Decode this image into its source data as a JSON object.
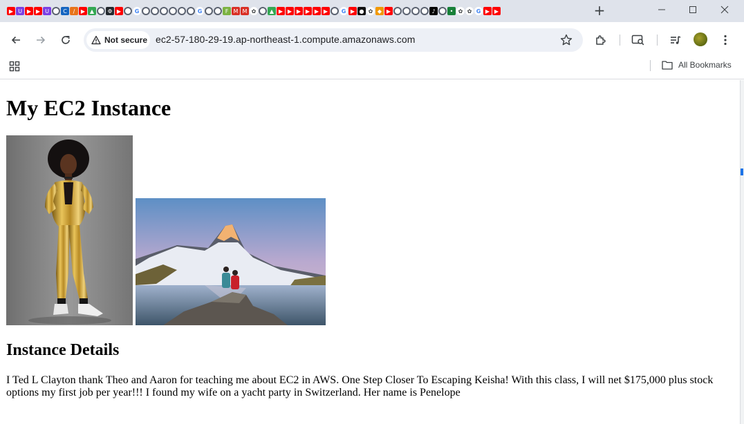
{
  "browser": {
    "tab_favicons": [
      {
        "name": "youtube-icon",
        "color": "#ff0000"
      },
      {
        "name": "u-icon",
        "color": "#7b3fe4"
      },
      {
        "name": "youtube-icon",
        "color": "#ff0000"
      },
      {
        "name": "youtube-icon",
        "color": "#ff0000"
      },
      {
        "name": "u-icon",
        "color": "#7b3fe4"
      },
      {
        "name": "globe-icon",
        "color": "#5f6368"
      },
      {
        "name": "c-icon",
        "color": "#1565c0"
      },
      {
        "name": "stripe-icon",
        "color": "#e8731a"
      },
      {
        "name": "youtube-icon",
        "color": "#ff0000"
      },
      {
        "name": "drive-icon",
        "color": "#34a853"
      },
      {
        "name": "globe-icon",
        "color": "#5f6368"
      },
      {
        "name": "gh-icon",
        "color": "#24292f"
      },
      {
        "name": "youtube-icon",
        "color": "#ff0000"
      },
      {
        "name": "globe-icon",
        "color": "#5f6368"
      },
      {
        "name": "google-icon",
        "color": "#4285f4"
      },
      {
        "name": "globe-icon",
        "color": "#5f6368"
      },
      {
        "name": "globe-icon",
        "color": "#5f6368"
      },
      {
        "name": "globe-icon",
        "color": "#5f6368"
      },
      {
        "name": "globe-icon",
        "color": "#5f6368"
      },
      {
        "name": "globe-icon",
        "color": "#5f6368"
      },
      {
        "name": "globe-icon",
        "color": "#5f6368"
      },
      {
        "name": "google-icon",
        "color": "#4285f4"
      },
      {
        "name": "globe-icon",
        "color": "#5f6368"
      },
      {
        "name": "globe-icon",
        "color": "#5f6368"
      },
      {
        "name": "f-icon",
        "color": "#7cb342"
      },
      {
        "name": "gmail-icon",
        "color": "#d93025"
      },
      {
        "name": "gmail-icon",
        "color": "#d93025"
      },
      {
        "name": "openai-icon",
        "color": "#3c4043"
      },
      {
        "name": "globe-icon",
        "color": "#5f6368"
      },
      {
        "name": "drive-icon",
        "color": "#34a853"
      },
      {
        "name": "youtube-icon",
        "color": "#ff0000"
      },
      {
        "name": "youtube-icon",
        "color": "#ff0000"
      },
      {
        "name": "youtube-icon",
        "color": "#ff0000"
      },
      {
        "name": "youtube-icon",
        "color": "#ff0000"
      },
      {
        "name": "youtube-icon",
        "color": "#ff0000"
      },
      {
        "name": "youtube-icon",
        "color": "#ff0000"
      },
      {
        "name": "globe-icon",
        "color": "#5f6368"
      },
      {
        "name": "google-icon",
        "color": "#4285f4"
      },
      {
        "name": "youtube-icon",
        "color": "#ff0000"
      },
      {
        "name": "dark-circle-icon",
        "color": "#111111"
      },
      {
        "name": "openai-icon",
        "color": "#3c4043"
      },
      {
        "name": "orange-icon",
        "color": "#f29900"
      },
      {
        "name": "youtube-icon",
        "color": "#ff0000"
      },
      {
        "name": "globe-icon",
        "color": "#5f6368"
      },
      {
        "name": "globe-icon",
        "color": "#5f6368"
      },
      {
        "name": "globe-icon",
        "color": "#5f6368"
      },
      {
        "name": "globe-icon",
        "color": "#5f6368"
      },
      {
        "name": "tiktok-icon",
        "color": "#000000"
      },
      {
        "name": "globe-icon",
        "color": "#5f6368"
      },
      {
        "name": "mic-icon",
        "color": "#188038"
      },
      {
        "name": "openai-icon",
        "color": "#3c4043"
      },
      {
        "name": "openai-icon",
        "color": "#3c4043"
      },
      {
        "name": "google-icon",
        "color": "#4285f4"
      },
      {
        "name": "youtube-icon",
        "color": "#ff0000"
      },
      {
        "name": "youtube-icon",
        "color": "#ff0000"
      }
    ],
    "new_tab_glyph": "+",
    "security_label": "Not secure",
    "url": "ec2-57-180-29-19.ap-northeast-1.compute.amazonaws.com",
    "bookmarks_label": "All Bookmarks"
  },
  "page": {
    "title": "My EC2 Instance",
    "images": [
      {
        "name": "woman-in-gold-jumpsuit"
      },
      {
        "name": "matterhorn-lake-hikers"
      }
    ],
    "section_title": "Instance Details",
    "details_text": "I Ted L Clayton thank Theo and Aaron for teaching me about EC2 in AWS. One Step Closer To Escaping Keisha! With this class, I will net $175,000 plus stock options my first job per year!!! I found my wife on a yacht party in Switzerland. Her name is Penelope"
  }
}
